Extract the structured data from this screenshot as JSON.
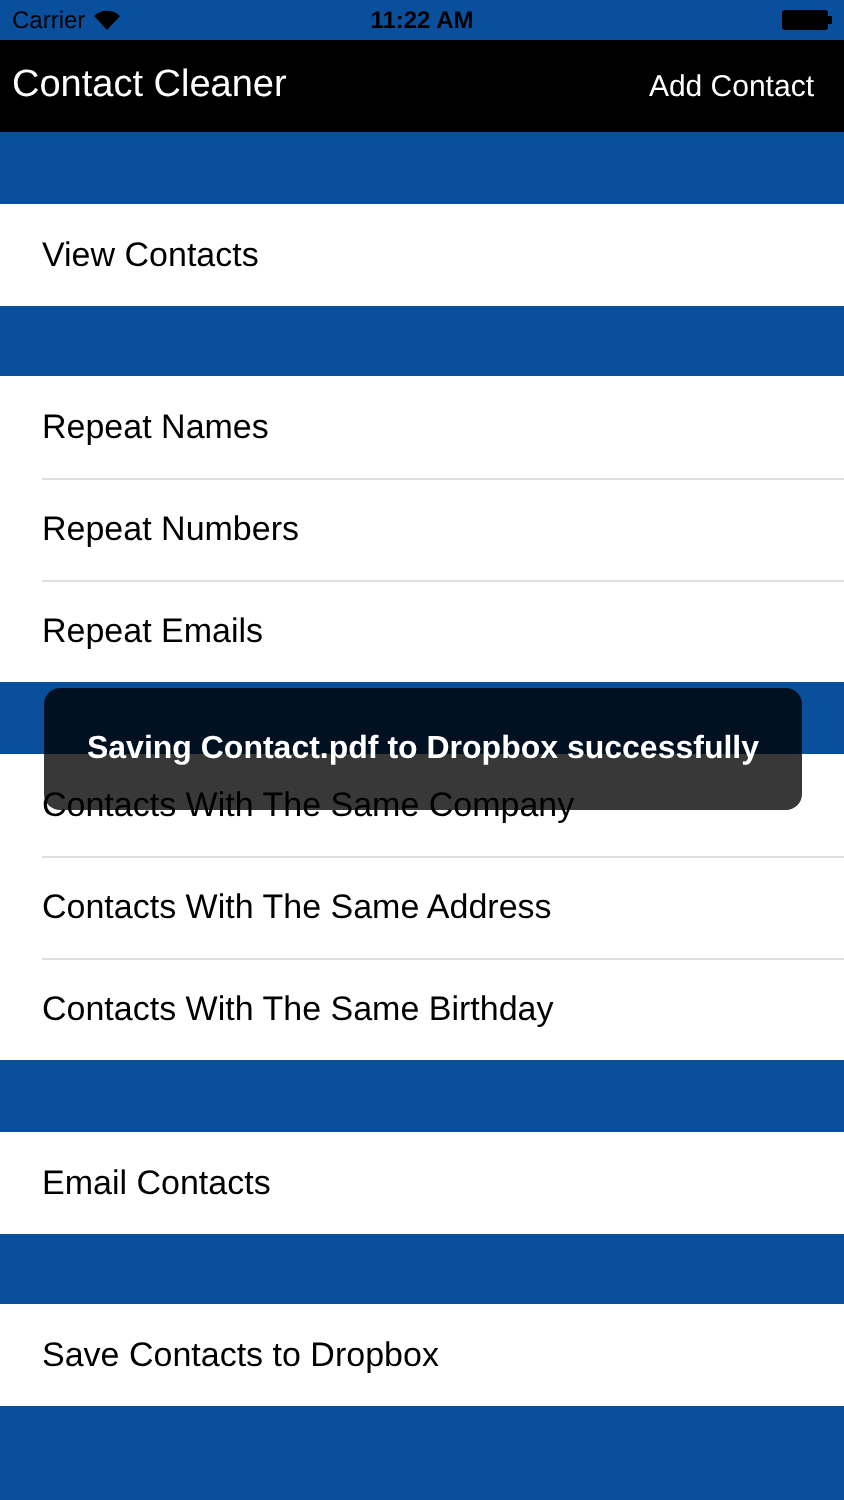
{
  "status_bar": {
    "carrier": "Carrier",
    "time": "11:22 AM"
  },
  "nav_bar": {
    "title": "Contact Cleaner",
    "action": "Add Contact"
  },
  "sections": [
    {
      "rows": [
        "View Contacts"
      ]
    },
    {
      "rows": [
        "Repeat Names",
        "Repeat Numbers",
        "Repeat Emails"
      ]
    },
    {
      "rows": [
        "Contacts With The Same Company",
        "Contacts With The Same Address",
        "Contacts With The Same Birthday"
      ]
    },
    {
      "rows": [
        "Email Contacts"
      ]
    },
    {
      "rows": [
        "Save Contacts to Dropbox"
      ]
    }
  ],
  "toast": {
    "message": "Saving Contact.pdf to Dropbox successfully"
  }
}
